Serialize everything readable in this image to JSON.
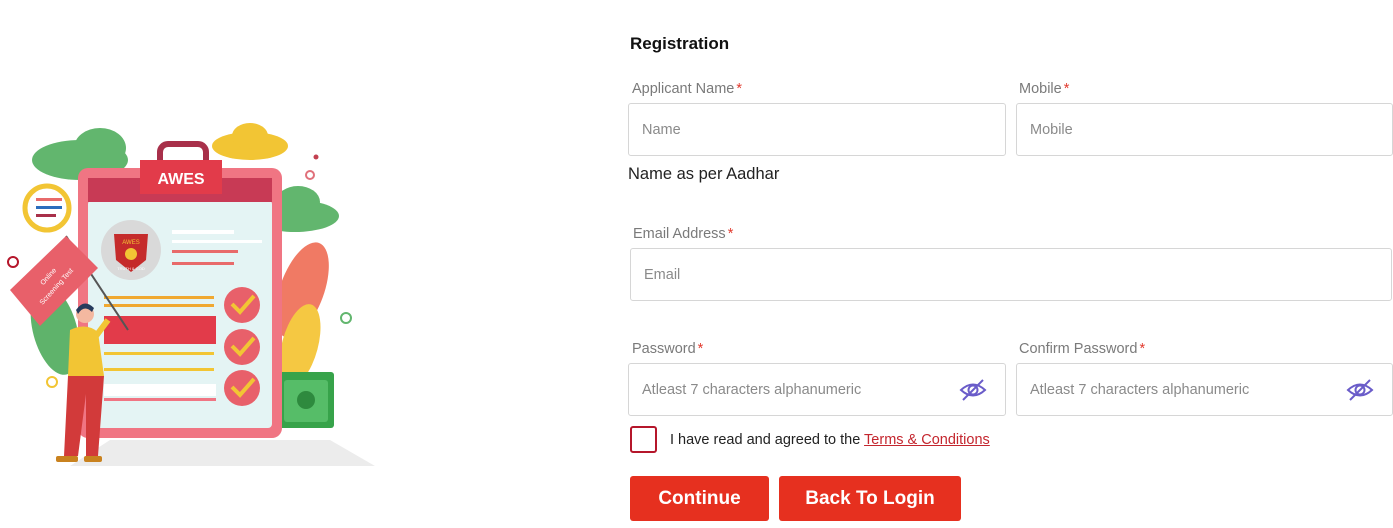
{
  "illustration": {
    "badge_text": "AWES",
    "flag_text_line1": "Online",
    "flag_text_line2": "Screening Test",
    "emblem_text_top": "AWES",
    "emblem_text_bottom": "TRUTH & GOD"
  },
  "form": {
    "title": "Registration",
    "required_mark": "*",
    "applicant_name": {
      "label": "Applicant Name",
      "placeholder": "Name",
      "value": ""
    },
    "mobile": {
      "label": "Mobile",
      "placeholder": "Mobile",
      "value": ""
    },
    "name_hint": "Name as per Aadhar",
    "email": {
      "label": "Email Address",
      "placeholder": "Email",
      "value": ""
    },
    "password": {
      "label": "Password",
      "placeholder": "Atleast 7 characters alphanumeric",
      "value": ""
    },
    "confirm_password": {
      "label": "Confirm Password",
      "placeholder": "Atleast 7 characters alphanumeric",
      "value": ""
    },
    "agreement_text": "I have read and agreed to the",
    "terms_link": "Terms & Conditions",
    "agreement_checked": false,
    "continue_label": "Continue",
    "back_label": "Back To Login"
  },
  "colors": {
    "primary": "#e6301f",
    "link": "#c4262e",
    "checkbox_border": "#b5162b",
    "eye_icon": "#6a5cc9"
  },
  "icons": [
    "eye-slash-icon",
    "check-icon",
    "clipboard-illustration",
    "emblem-icon",
    "flag-icon",
    "banknote-icon"
  ]
}
